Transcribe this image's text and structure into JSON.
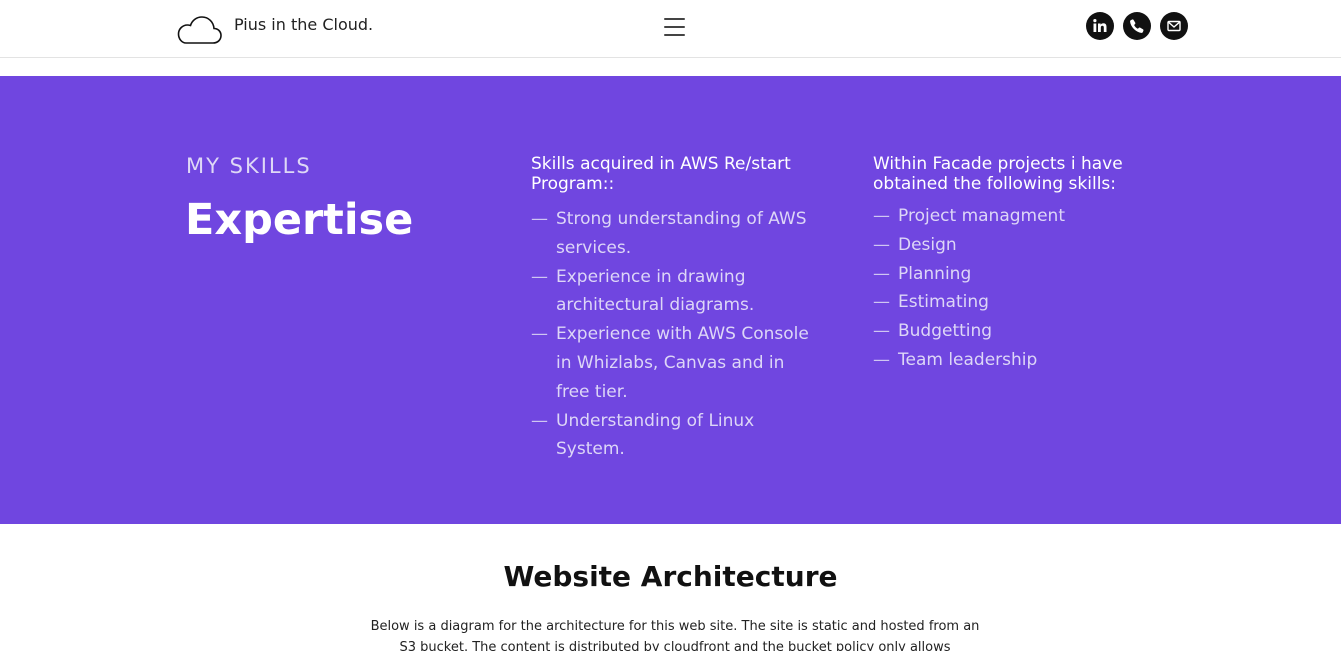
{
  "header": {
    "brand": "Pius in the Cloud.",
    "icons": [
      "cloud-logo-icon",
      "hamburger-menu-icon",
      "linkedin-icon",
      "phone-icon",
      "mail-icon"
    ]
  },
  "skills": {
    "kicker": "MY SKILLS",
    "heading": "Expertise",
    "background": "#7046e0",
    "column1": {
      "title": "Skills acquired in AWS Re/start Program::",
      "items": [
        "Strong understanding of AWS services.",
        "Experience in drawing architectural diagrams.",
        "Experience with AWS Console in Whizlabs, Canvas and in free tier.",
        "Understanding of Linux System."
      ]
    },
    "column2": {
      "title": "Within Facade projects i have obtained the following skills:",
      "items": [
        "Project managment",
        "Design",
        "Planning",
        "Estimating",
        "Budgetting",
        "Team leadership"
      ]
    },
    "dash": "—"
  },
  "architecture": {
    "title": "Website Architecture",
    "text": "Below is a diagram for the architecture for this web site. The site is static and hosted from an S3 bucket. The content is distributed by cloudfront and the bucket policy only allows"
  }
}
